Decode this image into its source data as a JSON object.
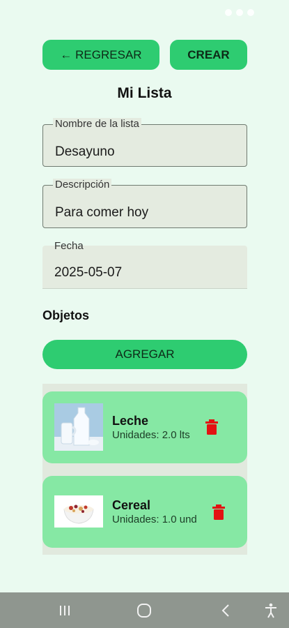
{
  "status_bar": {
    "time": ""
  },
  "header": {
    "back_label": "← REGRESAR",
    "create_label": "CREAR",
    "title": "Mi Lista"
  },
  "form": {
    "name": {
      "label": "Nombre de la lista",
      "value": "Desayuno"
    },
    "description": {
      "label": "Descripción",
      "value": "Para comer hoy"
    },
    "date": {
      "label": "Fecha",
      "value": "2025-05-07"
    }
  },
  "objects": {
    "heading": "Objetos",
    "add_label": "AGREGAR",
    "items": [
      {
        "name": "Leche",
        "quantity": "Unidades: 2.0 lts",
        "image_icon": "milk-photo"
      },
      {
        "name": "Cereal",
        "quantity": "Unidades: 1.0 und",
        "image_icon": "cereal-bowl-photo"
      }
    ]
  },
  "nav_bar": {
    "icons": [
      "recent-apps-icon",
      "home-icon",
      "back-icon",
      "accessibility-icon"
    ]
  },
  "colors": {
    "background": "#eafaf0",
    "accent": "#2ecc71",
    "card": "#86e8a4",
    "danger": "#e31212",
    "nav": "#8f968f"
  }
}
